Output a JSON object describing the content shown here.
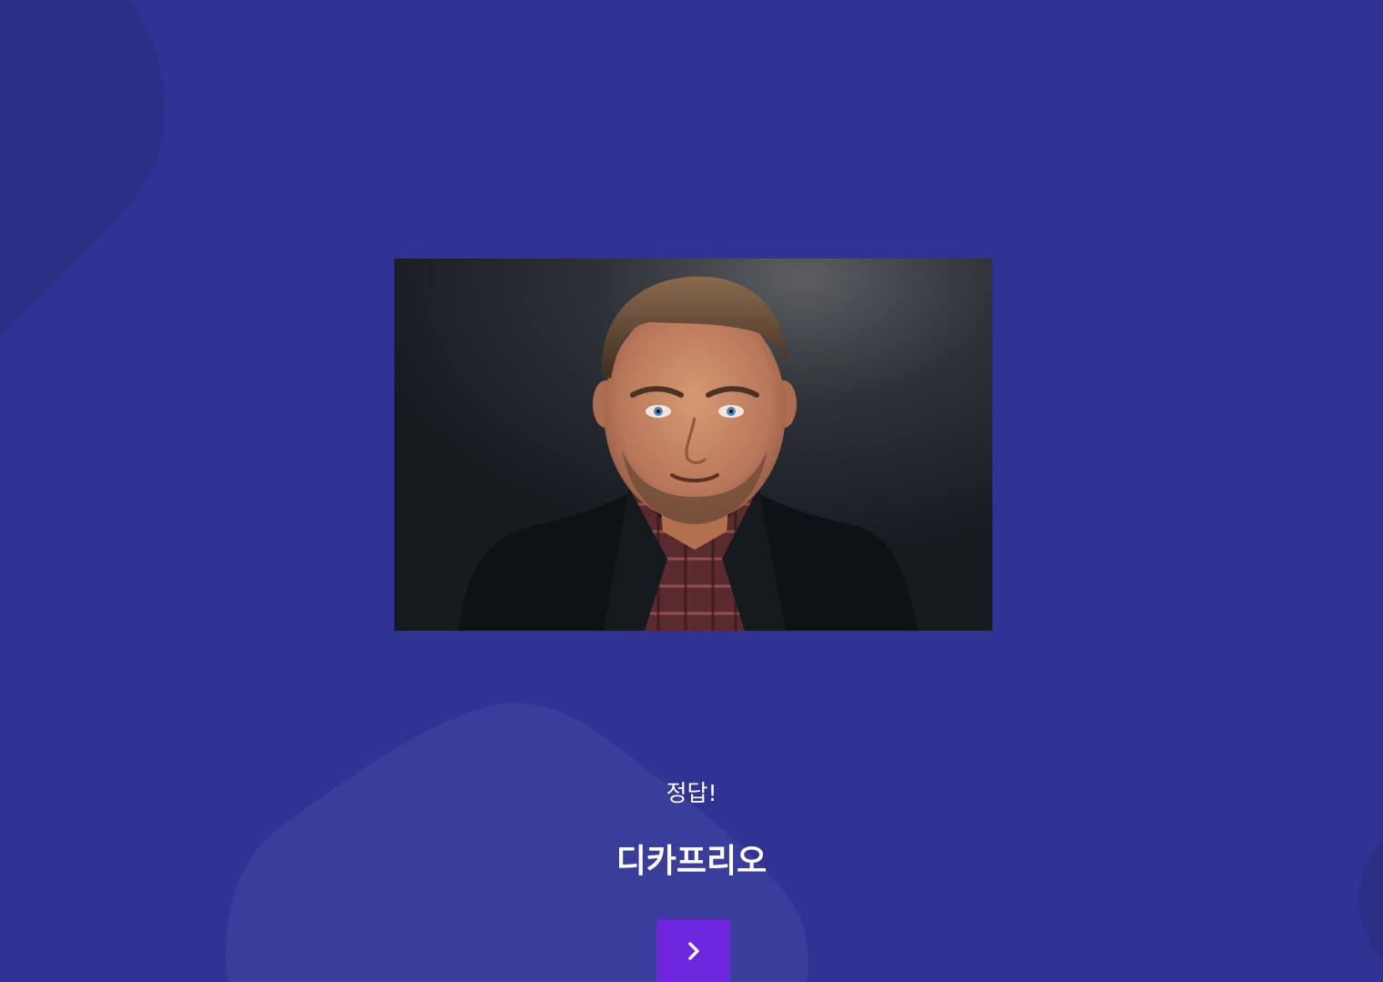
{
  "quiz": {
    "photo_subject": "portrait-photo",
    "result_label": "정답!",
    "answer": "디카프리오",
    "next_icon": "chevron-right-icon"
  },
  "colors": {
    "background": "#313394",
    "blob_dark": "#2c2f86",
    "blob_light": "#3b3d9a",
    "button": "#6e26de",
    "text": "#ffffff"
  }
}
